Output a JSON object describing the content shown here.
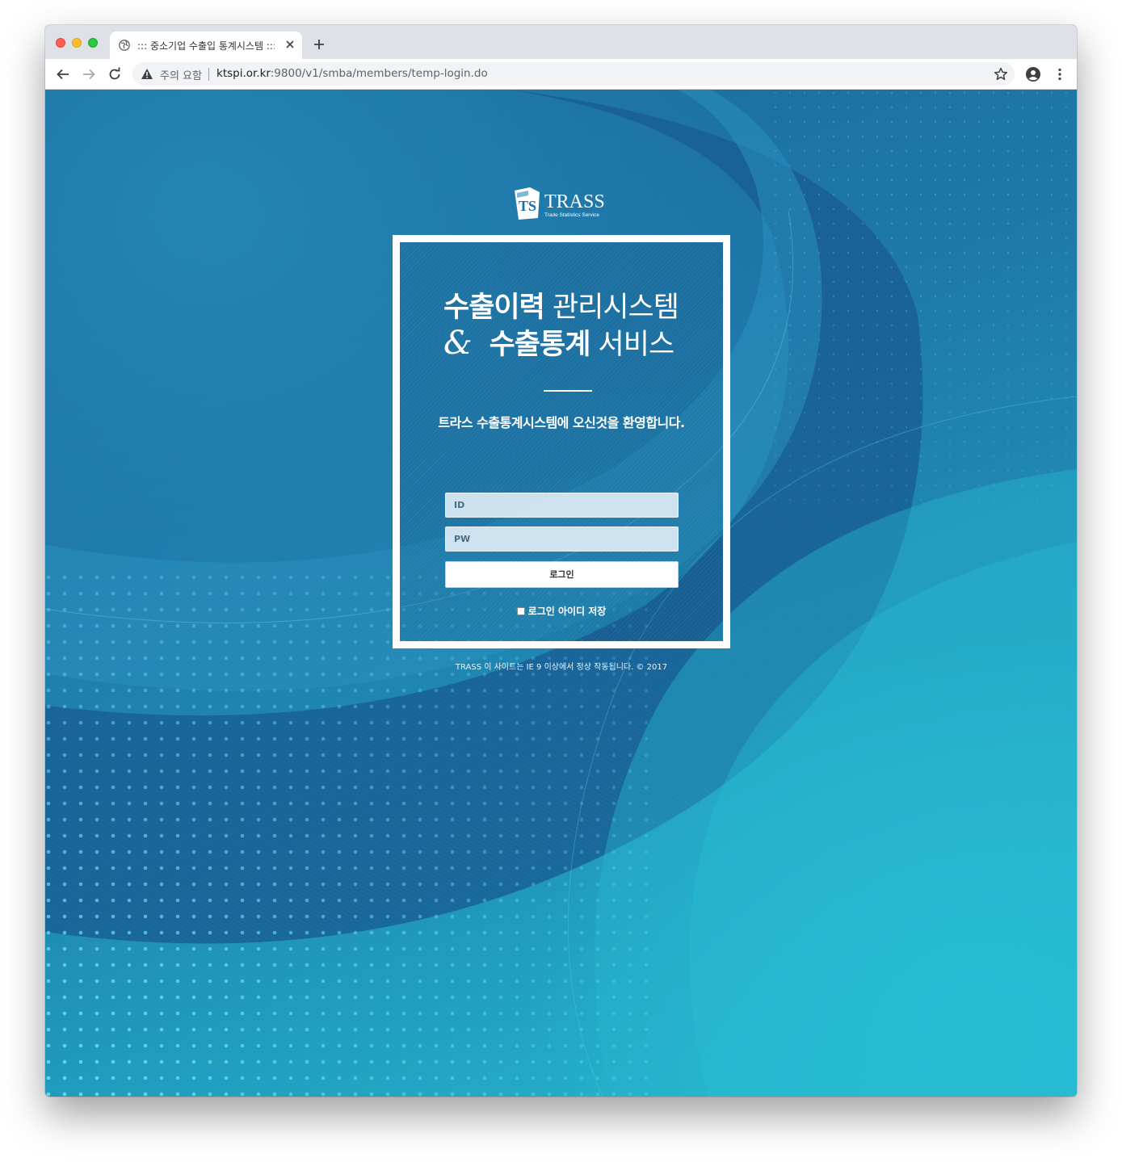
{
  "browser": {
    "tab_title": "::: 중소기업 수출입 통계시스템 :::",
    "security_label": "주의 요함",
    "url_host": "ktspi.or.kr",
    "url_rest": ":9800/v1/smba/members/temp-login.do"
  },
  "logo": {
    "badge": "TS",
    "name": "TRASS",
    "tagline": "Trade Statistics Service"
  },
  "login": {
    "title_line1_bold": "수출이력",
    "title_line1_light": " 관리시스템",
    "ampersand": "&",
    "title_line2_bold": "수출통계",
    "title_line2_light": " 서비스",
    "welcome": "트라스 수출통계시스템에 오신것을 환영합니다.",
    "id_placeholder": "ID",
    "pw_placeholder": "PW",
    "login_button": "로그인",
    "remember_label": "로그인 아이디 저장"
  },
  "footer": {
    "text": "TRASS 이 사이트는 IE 9 이상에서 정상 작동됩니다. © 2017"
  },
  "colors": {
    "bg_deep": "#1a6a9c",
    "bg_light": "#26b8d2",
    "dots": "#6fe0e6"
  }
}
